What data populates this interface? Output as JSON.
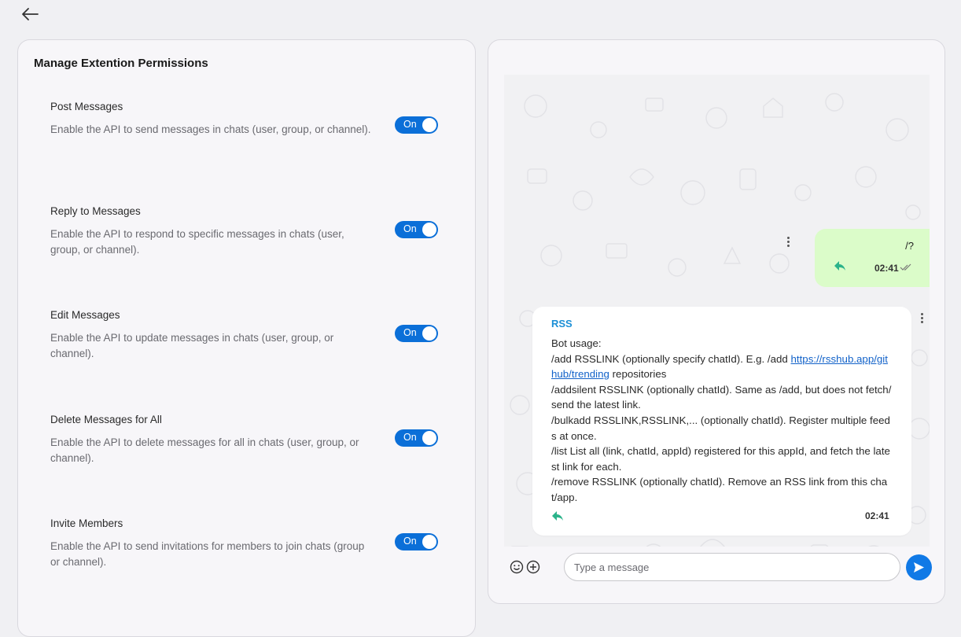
{
  "colors": {
    "accent": "#0b6fd8",
    "outgoing_bubble": "#dbfcc9",
    "sender_name": "#1b8fd6",
    "link": "#1262c9",
    "reply_icon": "#2bb38a"
  },
  "nav": {
    "back_icon": "arrow-left-icon"
  },
  "permissions": {
    "title": "Manage Extention Permissions",
    "items": [
      {
        "name": "Post Messages",
        "description": "Enable the API to send messages in chats (user, group, or channel).",
        "toggle_label": "On"
      },
      {
        "name": "Reply to Messages",
        "description": "Enable the API to respond to specific messages in chats (user, group, or channel).",
        "toggle_label": "On"
      },
      {
        "name": "Edit Messages",
        "description": "Enable the API to update messages in chats (user, group, or channel).",
        "toggle_label": "On"
      },
      {
        "name": "Delete Messages for All",
        "description": "Enable the API to delete messages for all in chats (user, group, or channel).",
        "toggle_label": "On"
      },
      {
        "name": "Invite Members",
        "description": "Enable the API to send invitations for members to join chats (group or channel).",
        "toggle_label": "On"
      }
    ]
  },
  "chat": {
    "outgoing": {
      "text": "/?",
      "time": "02:41",
      "icons": [
        "reply-icon",
        "double-check-icon",
        "more-vertical-icon"
      ]
    },
    "incoming": {
      "sender": "RSS",
      "line1": "Bot usage:",
      "line2_prefix": "/add RSSLINK (optionally specify chatId). E.g. /add ",
      "line2_link": "https://rsshub.app/github/trending",
      "line2_suffix": " repositories",
      "line3": "/addsilent RSSLINK (optionally chatId). Same as /add, but does not fetch/send the latest link.",
      "line4": "/bulkadd RSSLINK,RSSLINK,... (optionally chatId). Register multiple feeds at once.",
      "line5": "/list List all (link, chatId, appId) registered for this appId, and fetch the latest link for each.",
      "line6": "/remove RSSLINK (optionally chatId). Remove an RSS link from this chat/app.",
      "time": "02:41"
    },
    "composer": {
      "placeholder": "Type a message",
      "icons": [
        "emoji-icon",
        "add-icon",
        "send-icon"
      ]
    }
  }
}
